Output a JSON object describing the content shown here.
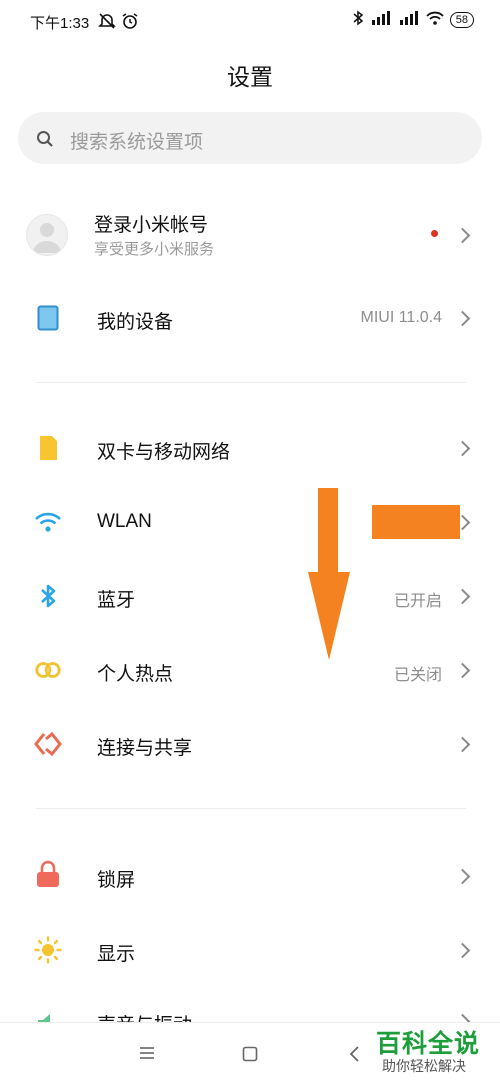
{
  "status_bar": {
    "time": "下午1:33",
    "battery": "58"
  },
  "header": {
    "title": "设置"
  },
  "search": {
    "placeholder": "搜索系统设置项"
  },
  "account": {
    "title": "登录小米帐号",
    "subtitle": "享受更多小米服务"
  },
  "device": {
    "label": "我的设备",
    "value": "MIUI 11.0.4"
  },
  "network_items": [
    {
      "label": "双卡与移动网络",
      "icon": "sim-icon",
      "value": ""
    },
    {
      "label": "WLAN",
      "icon": "wifi-icon",
      "value": ""
    },
    {
      "label": "蓝牙",
      "icon": "bluetooth-icon",
      "value": "已开启"
    },
    {
      "label": "个人热点",
      "icon": "hotspot-icon",
      "value": "已关闭"
    },
    {
      "label": "连接与共享",
      "icon": "connection-sharing-icon",
      "value": ""
    }
  ],
  "system_items": [
    {
      "label": "锁屏",
      "icon": "lock-icon"
    },
    {
      "label": "显示",
      "icon": "display-sun-icon"
    },
    {
      "label": "声音与振动",
      "icon": "sound-icon"
    }
  ],
  "watermark": {
    "title": "百科全说",
    "subtitle": "助你轻松解决"
  },
  "colors": {
    "accent_orange": "#f58220",
    "watermark_green": "#1e9e3a"
  }
}
